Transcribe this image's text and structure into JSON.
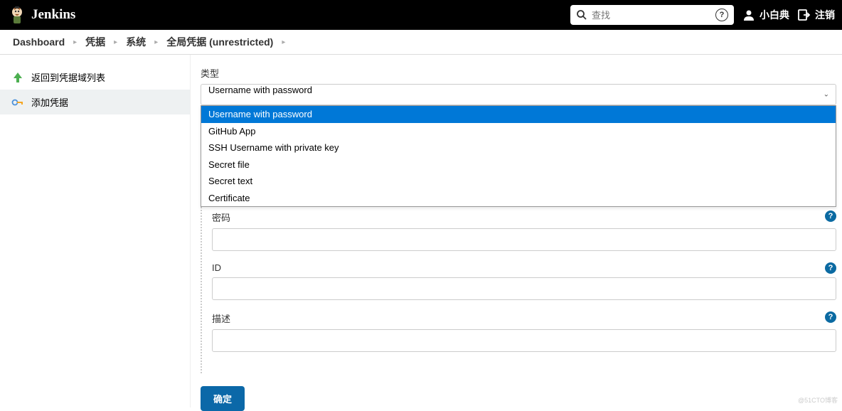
{
  "header": {
    "brand": "Jenkins",
    "search_placeholder": "查找",
    "user_name": "小白典",
    "logout_label": "注销"
  },
  "breadcrumb": {
    "items": [
      "Dashboard",
      "凭据",
      "系统",
      "全局凭据 (unrestricted)"
    ]
  },
  "sidebar": {
    "items": [
      {
        "label": "返回到凭据域列表"
      },
      {
        "label": "添加凭据"
      }
    ]
  },
  "form": {
    "type_label": "类型",
    "selected_type": "Username with password",
    "type_options": [
      "Username with password",
      "GitHub App",
      "SSH Username with private key",
      "Secret file",
      "Secret text",
      "Certificate"
    ],
    "password_label": "密码",
    "id_label": "ID",
    "description_label": "描述",
    "submit_label": "确定"
  },
  "watermark": "@51CTO博客"
}
